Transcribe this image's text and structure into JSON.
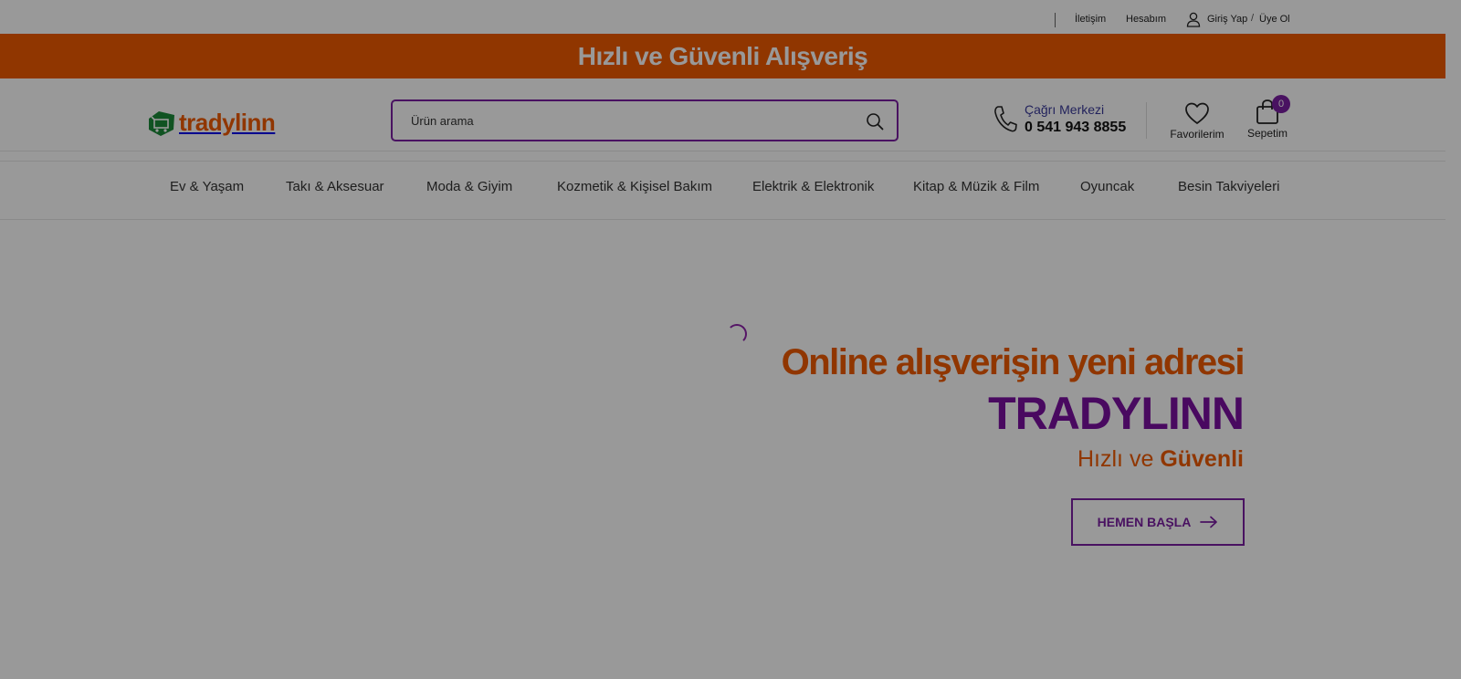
{
  "topbar": {
    "contact": "İletişim",
    "account": "Hesabım",
    "login": "Giriş Yap",
    "slash": "/",
    "register": "Üye Ol"
  },
  "announcement": "Hızlı ve Güvenli Alışveriş",
  "header": {
    "logo_text": "tradylinn",
    "search_placeholder": "Ürün arama",
    "callcenter_label": "Çağrı Merkezi",
    "callcenter_number": "0 541 943 8855",
    "favorites_label": "Favorilerim",
    "cart_label": "Sepetim",
    "cart_count": "0"
  },
  "categories": [
    "Ev & Yaşam",
    "Takı & Aksesuar",
    "Moda & Giyim",
    "Kozmetik & Kişisel Bakım",
    "Elektrik & Elektronik",
    "Kitap & Müzik & Film",
    "Oyuncak",
    "Besin Takviyeleri"
  ],
  "hero": {
    "title": "Online alışverişin yeni adresi",
    "brand": "TRADYLINN",
    "sub_plain": "Hızlı ve",
    "sub_bold": "Güvenli",
    "button_label": "HEMEN BAŞLA"
  },
  "colors": {
    "brand_orange": "#f15a00",
    "brand_purple": "#7b1fa2",
    "logo_green": "#1b8a3a"
  }
}
